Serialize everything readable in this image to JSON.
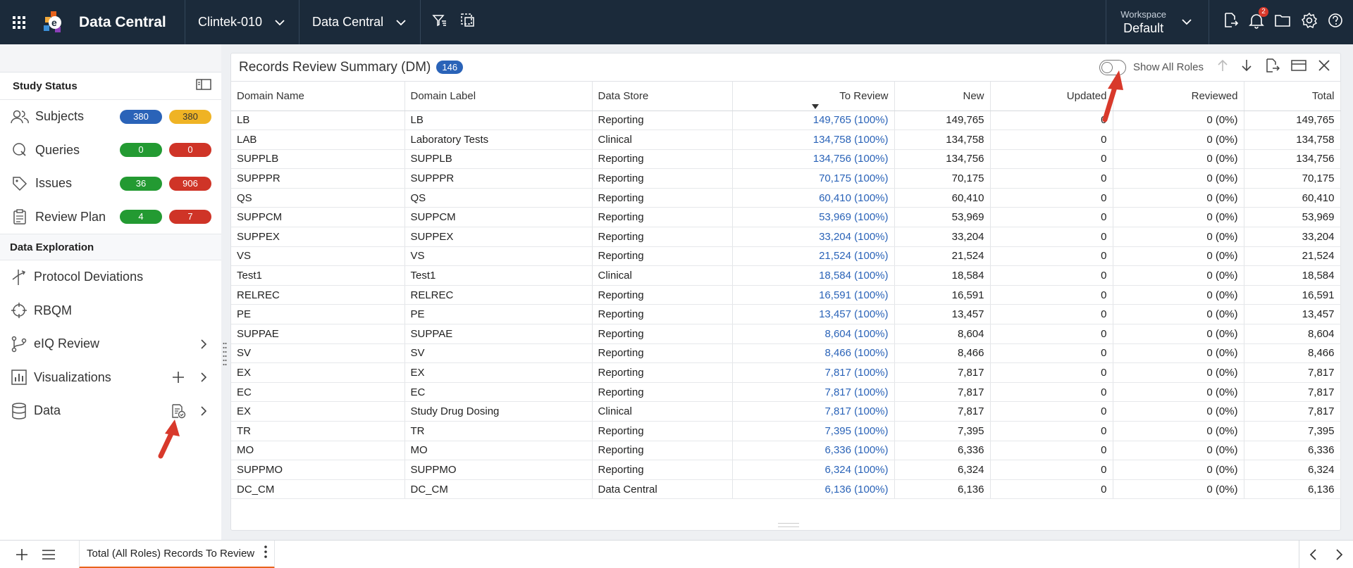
{
  "topbar": {
    "app_title": "Data Central",
    "study_dropdown": "Clintek-010",
    "module_dropdown": "Data Central",
    "workspace_label": "Workspace",
    "workspace_value": "Default",
    "notification_count": "2"
  },
  "sidebar": {
    "study_status_title": "Study Status",
    "status_items": [
      {
        "label": "Subjects",
        "a": "380",
        "b": "380"
      },
      {
        "label": "Queries",
        "a": "0",
        "b": "0"
      },
      {
        "label": "Issues",
        "a": "36",
        "b": "906"
      },
      {
        "label": "Review Plan",
        "a": "4",
        "b": "7"
      }
    ],
    "exploration_title": "Data Exploration",
    "explore_items": [
      {
        "label": "Protocol Deviations"
      },
      {
        "label": "RBQM"
      },
      {
        "label": "eIQ Review"
      },
      {
        "label": "Visualizations"
      },
      {
        "label": "Data"
      }
    ]
  },
  "panel": {
    "title": "Records Review Summary (DM)",
    "count": "146",
    "toggle_label": "Show All Roles",
    "columns": [
      "Domain Name",
      "Domain Label",
      "Data Store",
      "To Review",
      "New",
      "Updated",
      "Reviewed",
      "Total"
    ],
    "rows": [
      [
        "LB",
        "LB",
        "Reporting",
        "149,765 (100%)",
        "149,765",
        "0",
        "0 (0%)",
        "149,765"
      ],
      [
        "LAB",
        "Laboratory Tests",
        "Clinical",
        "134,758 (100%)",
        "134,758",
        "0",
        "0 (0%)",
        "134,758"
      ],
      [
        "SUPPLB",
        "SUPPLB",
        "Reporting",
        "134,756 (100%)",
        "134,756",
        "0",
        "0 (0%)",
        "134,756"
      ],
      [
        "SUPPPR",
        "SUPPPR",
        "Reporting",
        "70,175 (100%)",
        "70,175",
        "0",
        "0 (0%)",
        "70,175"
      ],
      [
        "QS",
        "QS",
        "Reporting",
        "60,410 (100%)",
        "60,410",
        "0",
        "0 (0%)",
        "60,410"
      ],
      [
        "SUPPCM",
        "SUPPCM",
        "Reporting",
        "53,969 (100%)",
        "53,969",
        "0",
        "0 (0%)",
        "53,969"
      ],
      [
        "SUPPEX",
        "SUPPEX",
        "Reporting",
        "33,204 (100%)",
        "33,204",
        "0",
        "0 (0%)",
        "33,204"
      ],
      [
        "VS",
        "VS",
        "Reporting",
        "21,524 (100%)",
        "21,524",
        "0",
        "0 (0%)",
        "21,524"
      ],
      [
        "Test1",
        "Test1",
        "Clinical",
        "18,584 (100%)",
        "18,584",
        "0",
        "0 (0%)",
        "18,584"
      ],
      [
        "RELREC",
        "RELREC",
        "Reporting",
        "16,591 (100%)",
        "16,591",
        "0",
        "0 (0%)",
        "16,591"
      ],
      [
        "PE",
        "PE",
        "Reporting",
        "13,457 (100%)",
        "13,457",
        "0",
        "0 (0%)",
        "13,457"
      ],
      [
        "SUPPAE",
        "SUPPAE",
        "Reporting",
        "8,604 (100%)",
        "8,604",
        "0",
        "0 (0%)",
        "8,604"
      ],
      [
        "SV",
        "SV",
        "Reporting",
        "8,466 (100%)",
        "8,466",
        "0",
        "0 (0%)",
        "8,466"
      ],
      [
        "EX",
        "EX",
        "Reporting",
        "7,817 (100%)",
        "7,817",
        "0",
        "0 (0%)",
        "7,817"
      ],
      [
        "EC",
        "EC",
        "Reporting",
        "7,817 (100%)",
        "7,817",
        "0",
        "0 (0%)",
        "7,817"
      ],
      [
        "EX",
        "Study Drug Dosing",
        "Clinical",
        "7,817 (100%)",
        "7,817",
        "0",
        "0 (0%)",
        "7,817"
      ],
      [
        "TR",
        "TR",
        "Reporting",
        "7,395 (100%)",
        "7,395",
        "0",
        "0 (0%)",
        "7,395"
      ],
      [
        "MO",
        "MO",
        "Reporting",
        "6,336 (100%)",
        "6,336",
        "0",
        "0 (0%)",
        "6,336"
      ],
      [
        "SUPPMO",
        "SUPPMO",
        "Reporting",
        "6,324 (100%)",
        "6,324",
        "0",
        "0 (0%)",
        "6,324"
      ],
      [
        "DC_CM",
        "DC_CM",
        "Data Central",
        "6,136 (100%)",
        "6,136",
        "0",
        "0 (0%)",
        "6,136"
      ]
    ]
  },
  "bottombar": {
    "tab_label": "Total (All Roles) Records To Review"
  },
  "colors": {
    "topbar": "#1b2a3a",
    "accent_blue": "#2a63b8",
    "arrow_red": "#d8392b",
    "tab_underline": "#e8631c"
  }
}
